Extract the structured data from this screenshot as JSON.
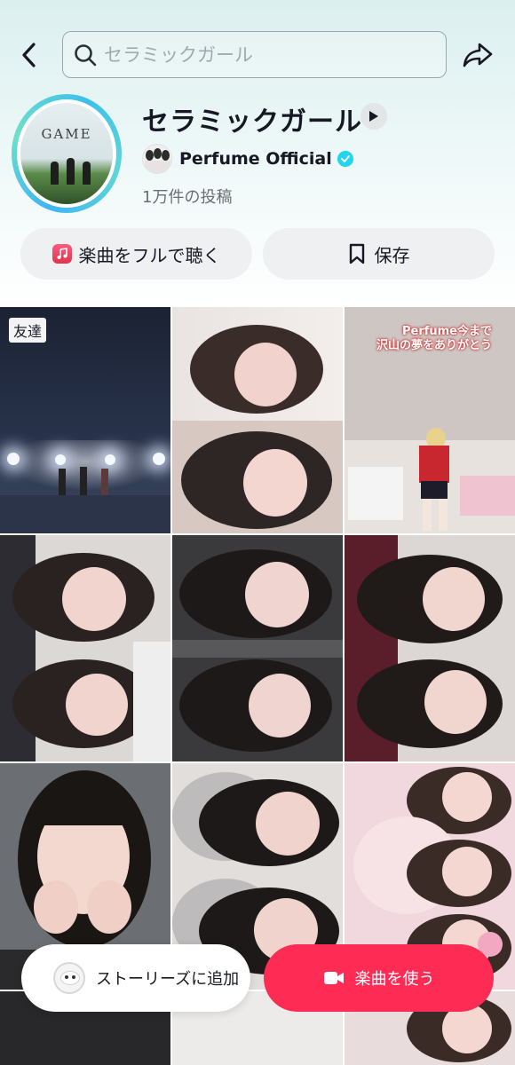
{
  "search": {
    "placeholder": "セラミックガール"
  },
  "sound": {
    "title": "セラミックガール",
    "artist": "Perfume Official",
    "posts": "1万件の投稿",
    "cover_text": "GAME"
  },
  "actions": {
    "full_song_label": "楽曲をフルで聴く",
    "save_label": "保存"
  },
  "grid": {
    "friend_tag": "友達",
    "caption_line1": "Perfume今まで",
    "caption_line2": "沢山の夢をありがとう"
  },
  "bottom": {
    "story_label": "ストーリーズに追加",
    "use_label": "楽曲を使う"
  },
  "colors": {
    "accent": "#fe2c55",
    "verified": "#20d5ec",
    "music_badge": "#e0344e"
  }
}
